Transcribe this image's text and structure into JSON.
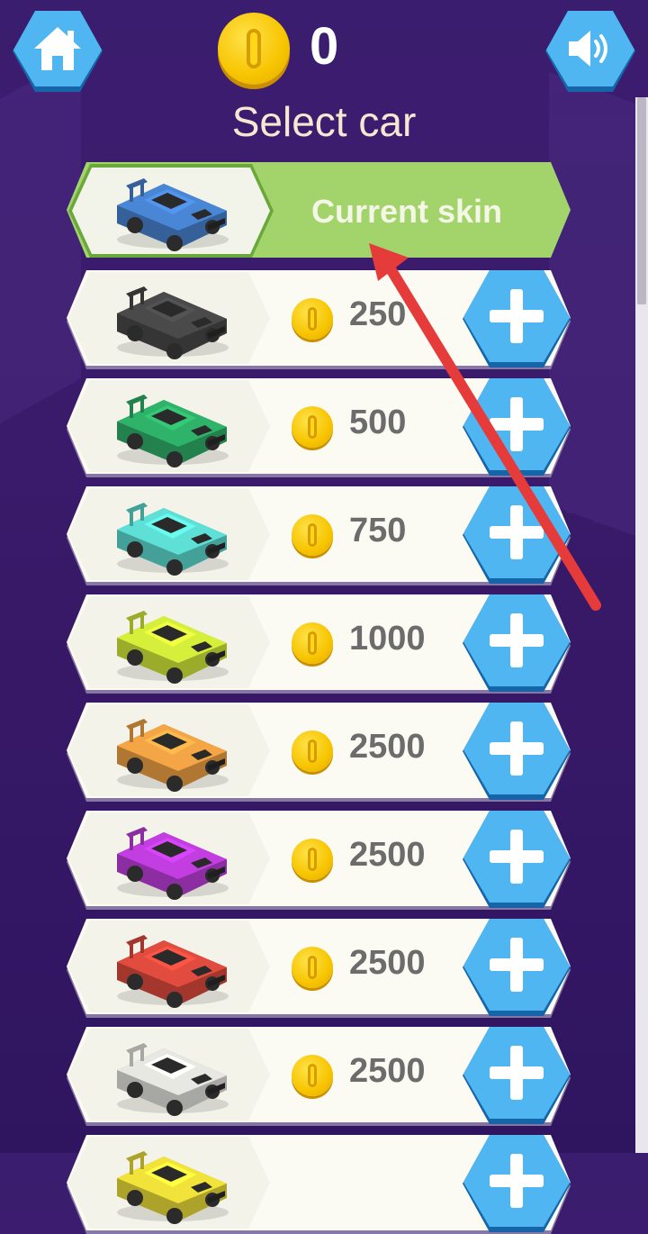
{
  "header": {
    "home_icon": "home-icon",
    "sound_icon": "speaker-icon",
    "coin_count": "0",
    "title": "Select car"
  },
  "current": {
    "label": "Current skin",
    "car_color": "#4a86d6"
  },
  "cars": [
    {
      "price": "250",
      "color": "#4a4a4a"
    },
    {
      "price": "500",
      "color": "#2fb36a"
    },
    {
      "price": "750",
      "color": "#5fe0d6"
    },
    {
      "price": "1000",
      "color": "#d6ef3a"
    },
    {
      "price": "2500",
      "color": "#f4a545"
    },
    {
      "price": "2500",
      "color": "#c23ee0"
    },
    {
      "price": "2500",
      "color": "#e24c3e"
    },
    {
      "price": "2500",
      "color": "#e8e8e2"
    },
    {
      "price": "",
      "color": "#f2e33a"
    }
  ],
  "colors": {
    "background": "#3b1d6f",
    "accent_blue": "#4fb6f2",
    "current_green": "#a3d46c",
    "arrow_red": "#e63b3b"
  }
}
